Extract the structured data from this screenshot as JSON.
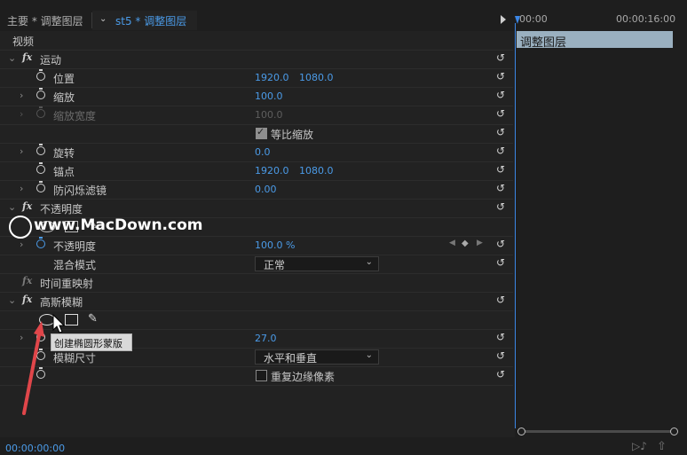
{
  "header": {
    "master_tab": "主要 * 调整图层",
    "sequence_tab": "st5 * 调整图层",
    "timecode_start": "00:00",
    "timecode_end": "00:00:16:00"
  },
  "panel": {
    "section_label": "视频",
    "motion": {
      "name": "运动",
      "position_label": "位置",
      "position_x": "1920.0",
      "position_y": "1080.0",
      "scale_label": "缩放",
      "scale_value": "100.0",
      "scale_width_label": "缩放宽度",
      "scale_width_value": "100.0",
      "uniform_scale_label": "等比缩放",
      "rotation_label": "旋转",
      "rotation_value": "0.0",
      "anchor_label": "锚点",
      "anchor_x": "1920.0",
      "anchor_y": "1080.0",
      "flicker_label": "防闪烁滤镜",
      "flicker_value": "0.00"
    },
    "opacity": {
      "name": "不透明度",
      "opacity_label": "不透明度",
      "opacity_value": "100.0 %",
      "blend_label": "混合模式",
      "blend_value": "正常"
    },
    "time_remap": {
      "name": "时间重映射"
    },
    "gaussian": {
      "name": "高斯模糊",
      "blurriness_value": "27.0",
      "dimension_label": "模糊尺寸",
      "dimension_value": "水平和垂直",
      "repeat_edge_label": "重复边缘像素"
    },
    "fx_label": "fx",
    "reset_glyph": "↺"
  },
  "tooltip": "创建椭圆形蒙版",
  "timeline": {
    "clip_label": "调整图层"
  },
  "footer": {
    "timecode": "00:00:00:00"
  },
  "watermark": {
    "text": "www.MacDown.com"
  },
  "colors": {
    "accent": "#4b9be8",
    "clip": "#9ab0c0",
    "arrow": "#e0464a"
  }
}
